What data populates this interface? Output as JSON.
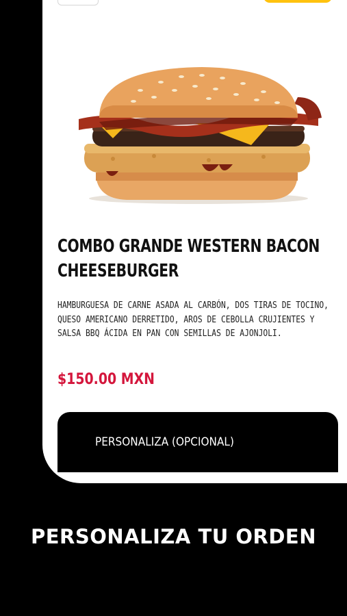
{
  "product": {
    "title": "COMBO GRANDE WESTERN BACON CHEESEBURGER",
    "description": "HAMBURGUESA DE CARNE ASADA AL CARBÓN, DOS TIRAS DE TOCINO, QUESO AMERICANO DERRETIDO, AROS DE CEBOLLA CRUJIENTES Y SALSA BBQ ÁCIDA EN PAN CON SEMILLAS DE AJONJOLI.",
    "price": "$150.00 MXN",
    "image_icon": "burger-image"
  },
  "actions": {
    "customize_label": "PERSONALIZA (OPCIONAL)"
  },
  "footer": {
    "heading": "PERSONALIZA TU ORDEN"
  },
  "colors": {
    "accent_yellow": "#ffc20e",
    "price_red": "#d4163c",
    "background": "#000000"
  }
}
